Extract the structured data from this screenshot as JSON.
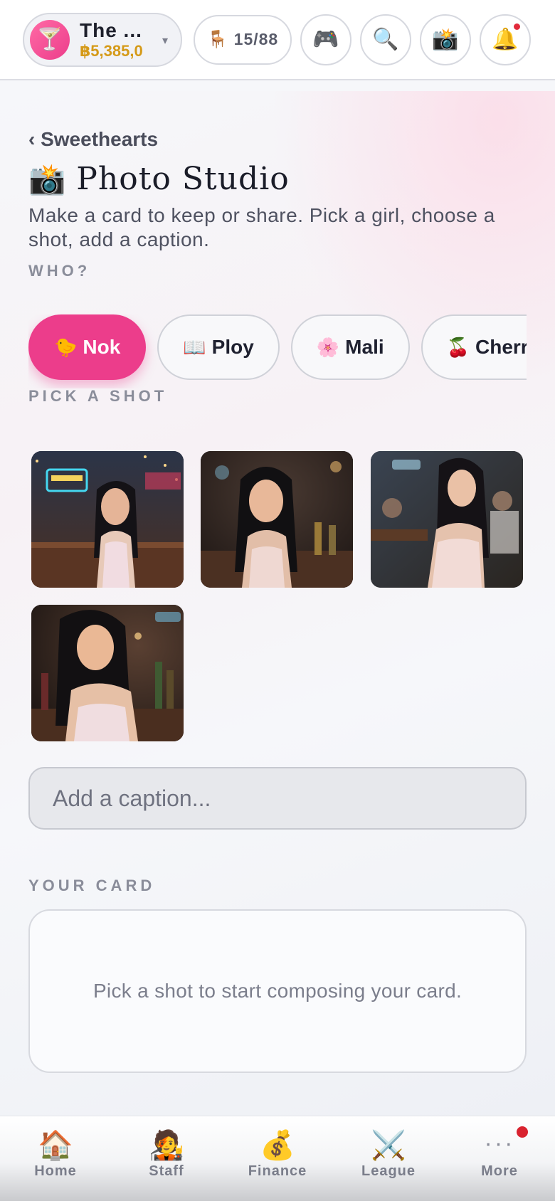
{
  "topbar": {
    "venue_name": "The ...",
    "venue_money": "฿5,385,0",
    "venue_icon": "cocktail-icon",
    "caret": "▾",
    "seat_icon": "chair-icon",
    "seats": "15/88",
    "buttons": [
      "gamepad-icon",
      "search-icon",
      "camera-icon",
      "bell-icon"
    ]
  },
  "header": {
    "back_label": "‹ Sweethearts",
    "title_icon": "📸",
    "title": "Photo Studio",
    "subtitle": "Make a card to keep or share. Pick a girl, choose a shot, add a caption."
  },
  "who": {
    "label": "WHO?",
    "girls": [
      {
        "emoji": "🐤",
        "name": "Nok",
        "active": true
      },
      {
        "emoji": "📖",
        "name": "Ploy",
        "active": false
      },
      {
        "emoji": "🌸",
        "name": "Mali",
        "active": false
      },
      {
        "emoji": "🍒",
        "name": "Cherry",
        "active": false
      }
    ]
  },
  "shots": {
    "label": "PICK A SHOT",
    "count": 4
  },
  "caption": {
    "placeholder": "Add a caption..."
  },
  "card": {
    "label": "YOUR CARD",
    "empty_text": "Pick a shot to start composing your card."
  },
  "nav": {
    "items": [
      {
        "icon": "🏠",
        "label": "Home"
      },
      {
        "icon": "🧑‍🎤",
        "label": "Staff"
      },
      {
        "icon": "💰",
        "label": "Finance"
      },
      {
        "icon": "⚔️",
        "label": "League"
      },
      {
        "icon": "···",
        "label": "More"
      }
    ]
  },
  "colors": {
    "accent": "#ec3d8b",
    "money": "#d59a18",
    "notification": "#e22b3b"
  }
}
